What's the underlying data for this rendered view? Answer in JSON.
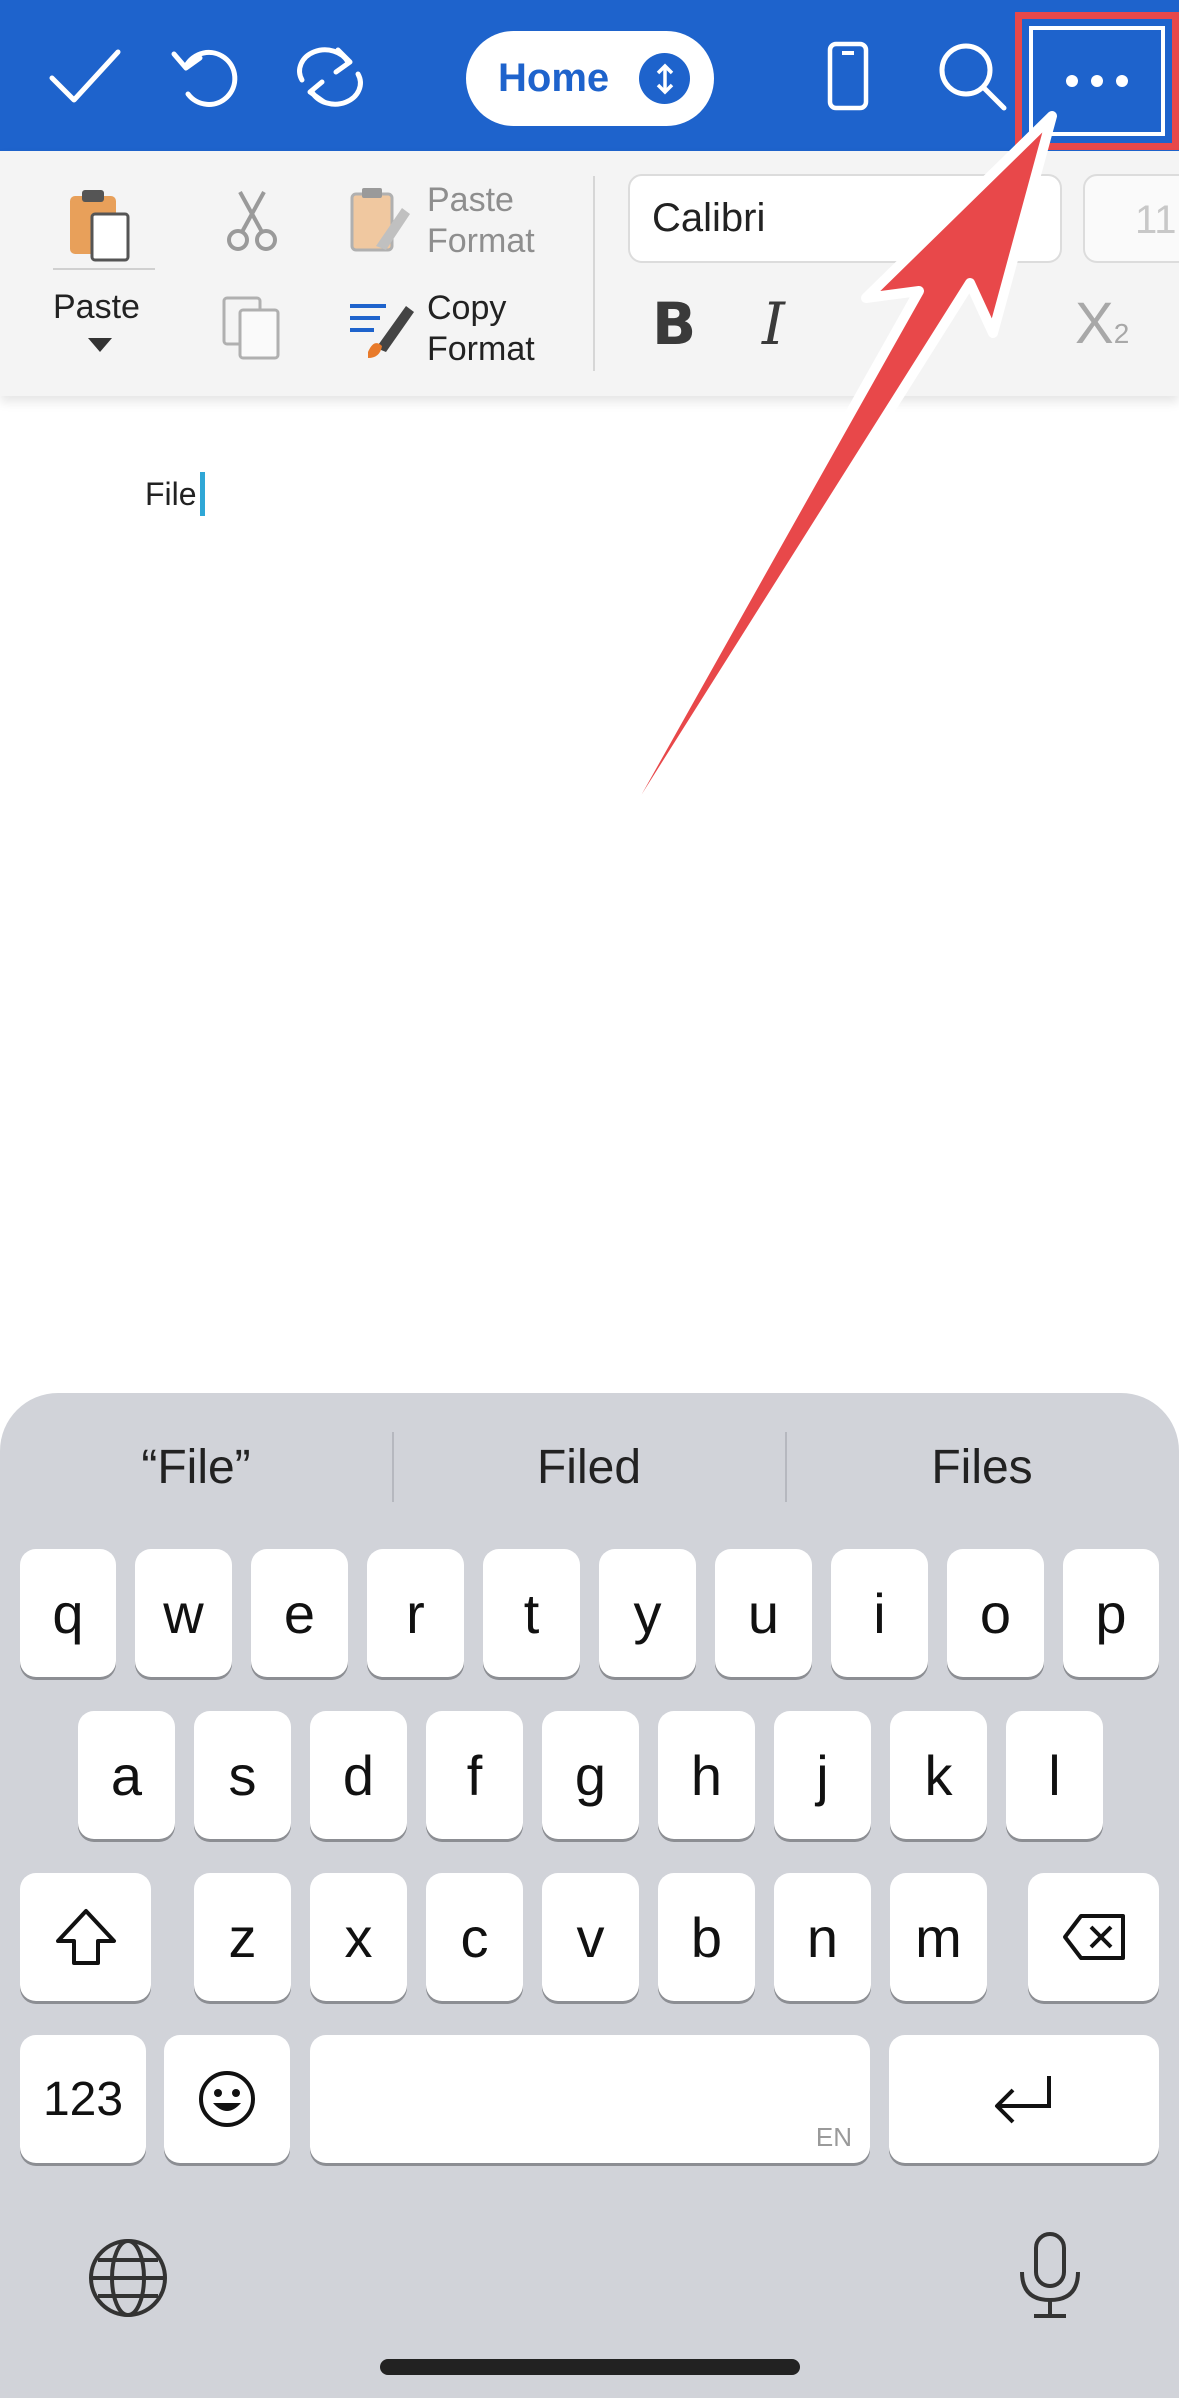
{
  "topbar": {
    "icons": [
      "checkmark-icon",
      "undo-icon",
      "redo-icon",
      "phone-view-icon",
      "search-icon",
      "more-icon"
    ],
    "mode_label": "Home"
  },
  "ribbon": {
    "paste_label": "Paste",
    "paste_format_line1": "Paste",
    "paste_format_line2": "Format",
    "copy_format_line1": "Copy",
    "copy_format_line2": "Format",
    "font_name": "Calibri",
    "font_size": "11",
    "bold": "B",
    "italic": "I",
    "subscript": "X",
    "subscript_sub": "2"
  },
  "document": {
    "text": "File"
  },
  "keyboard": {
    "suggestions": [
      "“File”",
      "Filed",
      "Files"
    ],
    "row1": [
      "q",
      "w",
      "e",
      "r",
      "t",
      "y",
      "u",
      "i",
      "o",
      "p"
    ],
    "row2": [
      "a",
      "s",
      "d",
      "f",
      "g",
      "h",
      "j",
      "k",
      "l"
    ],
    "row3": [
      "z",
      "x",
      "c",
      "v",
      "b",
      "n",
      "m"
    ],
    "numbers_key": "123",
    "space_language": "EN"
  },
  "colors": {
    "toolbar_blue": "#1e63cc",
    "highlight_red": "#e8484a",
    "keyboard_bg": "#d1d3d9"
  }
}
